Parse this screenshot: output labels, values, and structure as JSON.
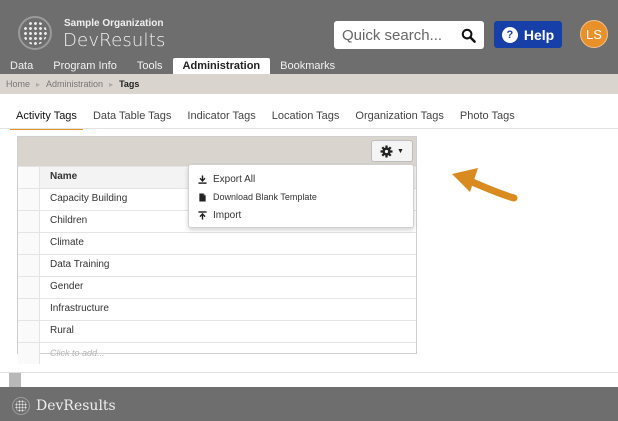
{
  "header": {
    "org_name": "Sample Organization",
    "app_name": "DevResults",
    "search_placeholder": "Quick search...",
    "help_label": "Help",
    "avatar_initials": "LS",
    "nav": [
      "Data",
      "Program Info",
      "Tools",
      "Administration",
      "Bookmarks"
    ],
    "active_nav": "Administration"
  },
  "breadcrumb": [
    "Home",
    "Administration",
    "Tags"
  ],
  "tabs": [
    "Activity Tags",
    "Data Table Tags",
    "Indicator Tags",
    "Location Tags",
    "Organization Tags",
    "Photo Tags"
  ],
  "grid": {
    "column_header": "Name",
    "rows": [
      "Capacity Building",
      "Children",
      "Climate",
      "Data Training",
      "Gender",
      "Infrastructure",
      "Rural"
    ],
    "add_placeholder": "Click to add..."
  },
  "menu": {
    "export_all": "Export All",
    "download_template": "Download Blank Template",
    "import": "Import"
  },
  "footer": {
    "app_name": "DevResults"
  },
  "colors": {
    "header_bg": "#6e6e6e",
    "accent_orange": "#e8902a",
    "help_blue": "#1640a8",
    "breadcrumb_bg": "#d9d4ce"
  }
}
